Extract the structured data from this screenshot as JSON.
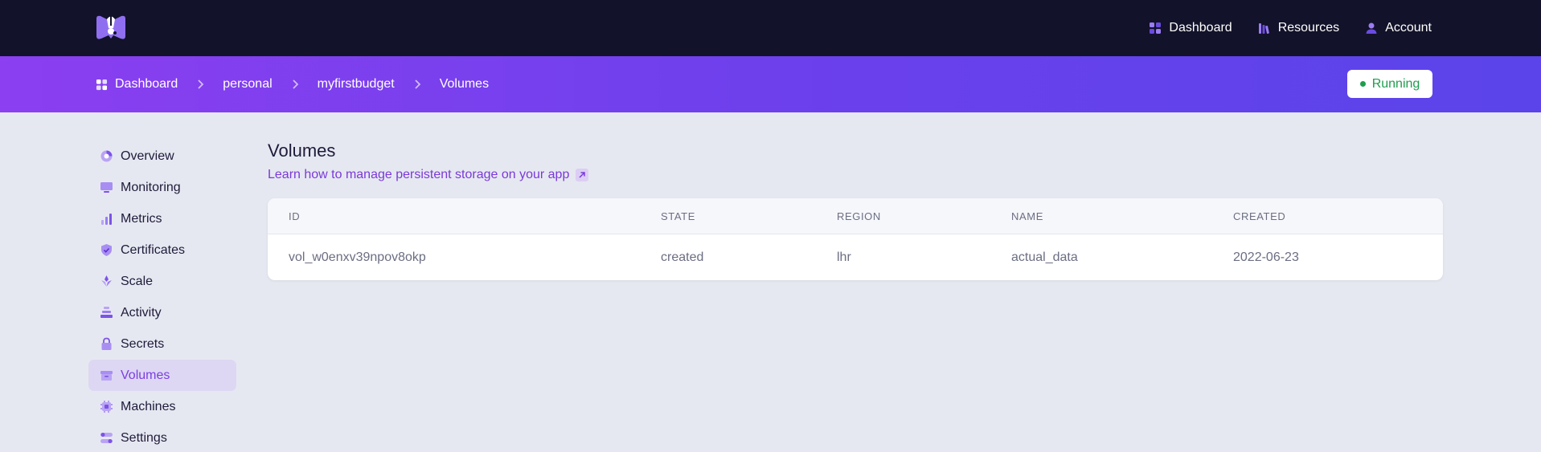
{
  "topbar": {
    "nav": [
      {
        "label": "Dashboard",
        "icon": "grid-icon"
      },
      {
        "label": "Resources",
        "icon": "library-icon"
      },
      {
        "label": "Account",
        "icon": "user-icon"
      }
    ]
  },
  "breadcrumb": {
    "items": [
      {
        "label": "Dashboard",
        "icon": "grid-icon"
      },
      {
        "label": "personal"
      },
      {
        "label": "myfirstbudget"
      },
      {
        "label": "Volumes"
      }
    ]
  },
  "status": {
    "label": "Running",
    "color": "#1f9d4f"
  },
  "sidebar": {
    "active": "Volumes",
    "items": [
      {
        "label": "Overview",
        "icon": "overview-icon"
      },
      {
        "label": "Monitoring",
        "icon": "monitor-icon"
      },
      {
        "label": "Metrics",
        "icon": "chart-bars-icon"
      },
      {
        "label": "Certificates",
        "icon": "shield-check-icon"
      },
      {
        "label": "Scale",
        "icon": "scale-icon"
      },
      {
        "label": "Activity",
        "icon": "stack-icon"
      },
      {
        "label": "Secrets",
        "icon": "lock-icon"
      },
      {
        "label": "Volumes",
        "icon": "archive-icon"
      },
      {
        "label": "Machines",
        "icon": "chip-icon"
      },
      {
        "label": "Settings",
        "icon": "toggles-icon"
      }
    ]
  },
  "main": {
    "title": "Volumes",
    "help_link": "Learn how to manage persistent storage on your app",
    "table": {
      "columns": [
        "ID",
        "STATE",
        "REGION",
        "NAME",
        "CREATED"
      ],
      "rows": [
        [
          "vol_w0enxv39npov8okp",
          "created",
          "lhr",
          "actual_data",
          "2022-06-23"
        ]
      ]
    }
  },
  "colors": {
    "topbar": "#12122a",
    "accent": "#7a3ad8",
    "background": "#e6e8f1"
  }
}
